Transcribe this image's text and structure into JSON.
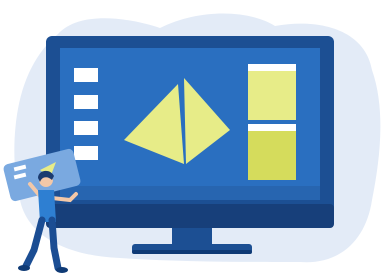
{
  "illustration": {
    "subject": "desktop-monitor-with-person-holding-card",
    "colors": {
      "background_blob": "#e3ebf7",
      "monitor_frame": "#1c4f93",
      "monitor_dark": "#0f3a75",
      "screen": "#2a6fc0",
      "screen_shade": "#2765b0",
      "screen_item": "#ffffff",
      "accent_yellow": "#e7ec88",
      "accent_yellow_dark": "#d5dc5c",
      "panel_white": "#ffffff",
      "person_skin": "#f3c8a8",
      "person_shirt": "#2e7fd2",
      "person_pants": "#1b4d93",
      "card": "#7aa9e0"
    }
  }
}
